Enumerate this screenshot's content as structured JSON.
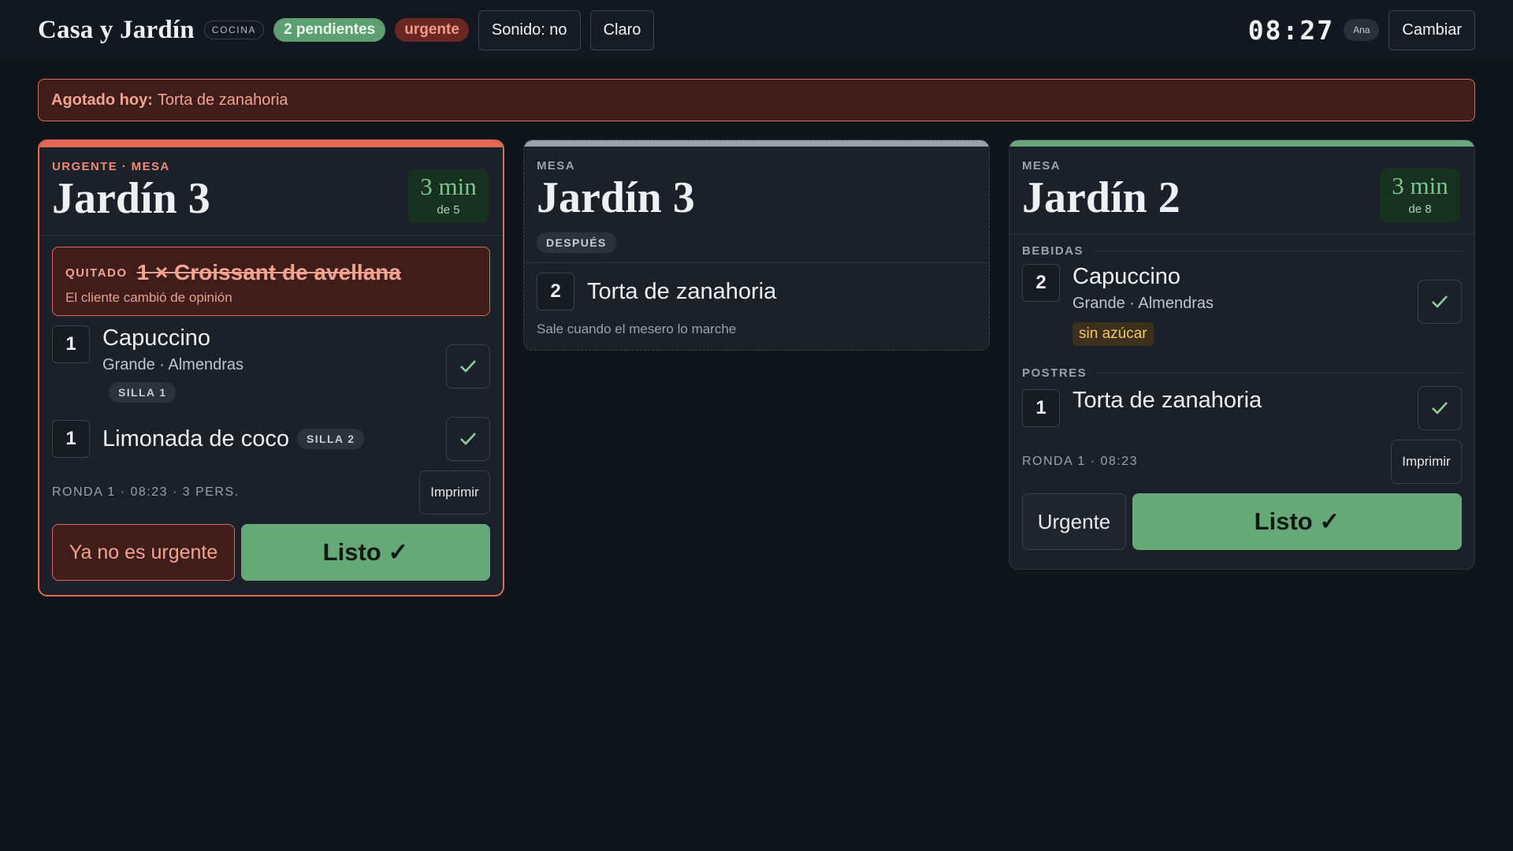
{
  "header": {
    "brand": "Casa y Jardín",
    "station": "COCINA",
    "pending": "2 pendientes",
    "urgent": "urgente",
    "sound_btn": "Sonido: no",
    "theme_btn": "Claro",
    "clock": "08:27",
    "user": "Ana",
    "change_btn": "Cambiar"
  },
  "alert": {
    "label": "Agotado hoy:",
    "item": "Torta de zanahoria"
  },
  "cards": [
    {
      "kicker": "URGENTE · MESA",
      "table": "Jardín 3",
      "timer_main": "3 min",
      "timer_sub": "de 5",
      "removed": {
        "label": "QUITADO",
        "text": "1 × Croissant de avellana",
        "note": "El cliente cambió de opinión"
      },
      "items": [
        {
          "qty": "1",
          "name": "Capuccino",
          "sub": "Grande · Almendras",
          "seat": "SILLA 1"
        },
        {
          "qty": "1",
          "name": "Limonada de coco",
          "seat": "SILLA 2"
        }
      ],
      "meta": "RONDA 1 · 08:23 · 3 PERS.",
      "print_btn": "Imprimir",
      "urgent_btn": "Ya no es urgente",
      "ready_btn": "Listo ✓"
    },
    {
      "kicker": "MESA",
      "table": "Jardín 3",
      "badge": "DESPUÉS",
      "items": [
        {
          "qty": "2",
          "name": "Torta de zanahoria"
        }
      ],
      "note": "Sale cuando el mesero lo marche"
    },
    {
      "kicker": "MESA",
      "table": "Jardín 2",
      "timer_main": "3 min",
      "timer_sub": "de 8",
      "sections": [
        {
          "label": "BEBIDAS",
          "items": [
            {
              "qty": "2",
              "name": "Capuccino",
              "sub": "Grande · Almendras",
              "tag": "sin azúcar"
            }
          ]
        },
        {
          "label": "POSTRES",
          "items": [
            {
              "qty": "1",
              "name": "Torta de zanahoria"
            }
          ]
        }
      ],
      "meta": "RONDA 1 · 08:23",
      "print_btn": "Imprimir",
      "urgent_btn": "Urgente",
      "ready_btn": "Listo ✓"
    }
  ],
  "colors": {
    "background": "#10141b",
    "card": "#1b2029",
    "accent_green": "#67a878",
    "urgent_red": "#e06a55",
    "neutral_strip": "#9aa1ac"
  },
  "icons": {
    "check": "check-icon"
  }
}
